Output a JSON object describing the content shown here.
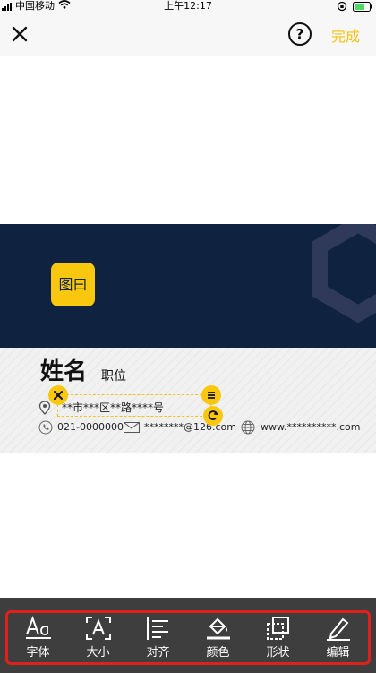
{
  "status_bar": {
    "carrier": "中国移动",
    "time": "上午12:17"
  },
  "nav": {
    "done_label": "完成",
    "help_label": "?"
  },
  "card": {
    "logo_text": "图曰",
    "name": "姓名",
    "position": "职位",
    "address": "**市***区**路****号",
    "phone": "021-0000000",
    "email": "********@126.com",
    "website": "www.**********.com"
  },
  "toolbar": {
    "items": [
      {
        "label": "字体",
        "icon": "font-icon"
      },
      {
        "label": "大小",
        "icon": "size-icon"
      },
      {
        "label": "对齐",
        "icon": "align-icon"
      },
      {
        "label": "颜色",
        "icon": "color-bucket-icon"
      },
      {
        "label": "形状",
        "icon": "shape-icon"
      },
      {
        "label": "编辑",
        "icon": "edit-pencil-icon"
      }
    ]
  },
  "colors": {
    "accent": "#f5c211",
    "card_dark": "#0f2340",
    "toolbar_bg": "#3e3e3e",
    "highlight_border": "#e0201b"
  }
}
